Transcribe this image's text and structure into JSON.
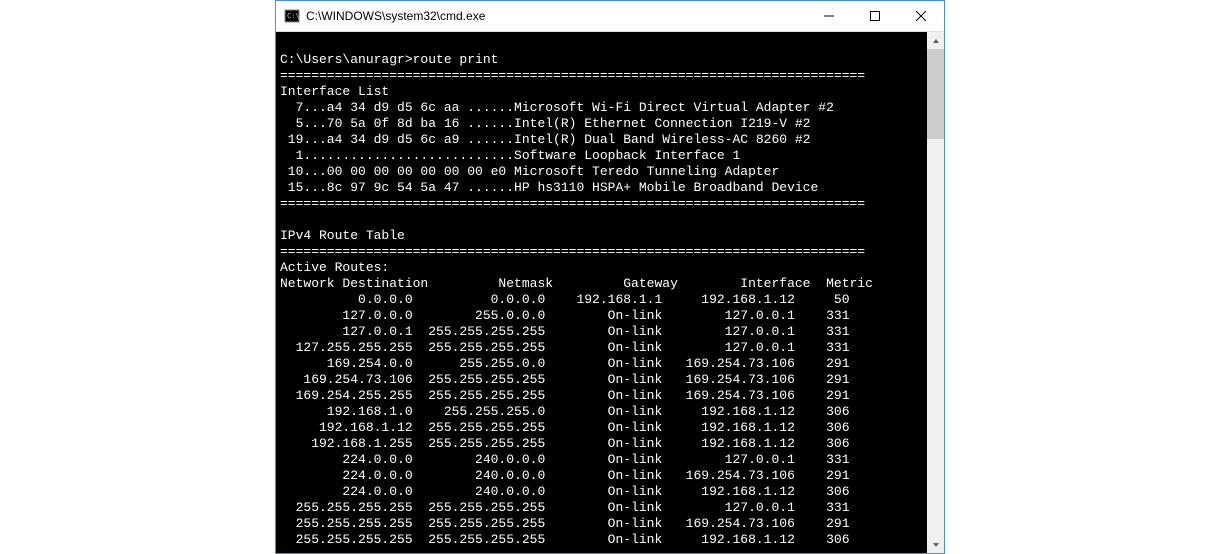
{
  "window": {
    "title": "C:\\WINDOWS\\system32\\cmd.exe"
  },
  "prompt": "C:\\Users\\anuragr>",
  "command": "route print",
  "interface_list_header": "Interface List",
  "interfaces": [
    {
      "idx": "7",
      "mac": "a4 34 d9 d5 6c aa",
      "dots": "......",
      "name": "Microsoft Wi-Fi Direct Virtual Adapter #2"
    },
    {
      "idx": "5",
      "mac": "70 5a 0f 8d ba 16",
      "dots": "......",
      "name": "Intel(R) Ethernet Connection I219-V #2"
    },
    {
      "idx": "19",
      "mac": "a4 34 d9 d5 6c a9",
      "dots": "......",
      "name": "Intel(R) Dual Band Wireless-AC 8260 #2"
    },
    {
      "idx": "1",
      "mac": "",
      "dots": "...........................",
      "name": "Software Loopback Interface 1"
    },
    {
      "idx": "10",
      "mac": "00 00 00 00 00 00 00 e0",
      "dots": "",
      "name": "Microsoft Teredo Tunneling Adapter"
    },
    {
      "idx": "15",
      "mac": "8c 97 9c 54 5a 47",
      "dots": "......",
      "name": "HP hs3110 HSPA+ Mobile Broadband Device"
    }
  ],
  "ipv4_header": "IPv4 Route Table",
  "active_routes_label": "Active Routes:",
  "route_columns": {
    "dest": "Network Destination",
    "mask": "Netmask",
    "gateway": "Gateway",
    "iface": "Interface",
    "metric": "Metric"
  },
  "routes": [
    {
      "dest": "0.0.0.0",
      "mask": "0.0.0.0",
      "gateway": "192.168.1.1",
      "iface": "192.168.1.12",
      "metric": "50"
    },
    {
      "dest": "127.0.0.0",
      "mask": "255.0.0.0",
      "gateway": "On-link",
      "iface": "127.0.0.1",
      "metric": "331"
    },
    {
      "dest": "127.0.0.1",
      "mask": "255.255.255.255",
      "gateway": "On-link",
      "iface": "127.0.0.1",
      "metric": "331"
    },
    {
      "dest": "127.255.255.255",
      "mask": "255.255.255.255",
      "gateway": "On-link",
      "iface": "127.0.0.1",
      "metric": "331"
    },
    {
      "dest": "169.254.0.0",
      "mask": "255.255.0.0",
      "gateway": "On-link",
      "iface": "169.254.73.106",
      "metric": "291"
    },
    {
      "dest": "169.254.73.106",
      "mask": "255.255.255.255",
      "gateway": "On-link",
      "iface": "169.254.73.106",
      "metric": "291"
    },
    {
      "dest": "169.254.255.255",
      "mask": "255.255.255.255",
      "gateway": "On-link",
      "iface": "169.254.73.106",
      "metric": "291"
    },
    {
      "dest": "192.168.1.0",
      "mask": "255.255.255.0",
      "gateway": "On-link",
      "iface": "192.168.1.12",
      "metric": "306"
    },
    {
      "dest": "192.168.1.12",
      "mask": "255.255.255.255",
      "gateway": "On-link",
      "iface": "192.168.1.12",
      "metric": "306"
    },
    {
      "dest": "192.168.1.255",
      "mask": "255.255.255.255",
      "gateway": "On-link",
      "iface": "192.168.1.12",
      "metric": "306"
    },
    {
      "dest": "224.0.0.0",
      "mask": "240.0.0.0",
      "gateway": "On-link",
      "iface": "127.0.0.1",
      "metric": "331"
    },
    {
      "dest": "224.0.0.0",
      "mask": "240.0.0.0",
      "gateway": "On-link",
      "iface": "169.254.73.106",
      "metric": "291"
    },
    {
      "dest": "224.0.0.0",
      "mask": "240.0.0.0",
      "gateway": "On-link",
      "iface": "192.168.1.12",
      "metric": "306"
    },
    {
      "dest": "255.255.255.255",
      "mask": "255.255.255.255",
      "gateway": "On-link",
      "iface": "127.0.0.1",
      "metric": "331"
    },
    {
      "dest": "255.255.255.255",
      "mask": "255.255.255.255",
      "gateway": "On-link",
      "iface": "169.254.73.106",
      "metric": "291"
    },
    {
      "dest": "255.255.255.255",
      "mask": "255.255.255.255",
      "gateway": "On-link",
      "iface": "192.168.1.12",
      "metric": "306"
    }
  ],
  "separator": "==========================================================================="
}
